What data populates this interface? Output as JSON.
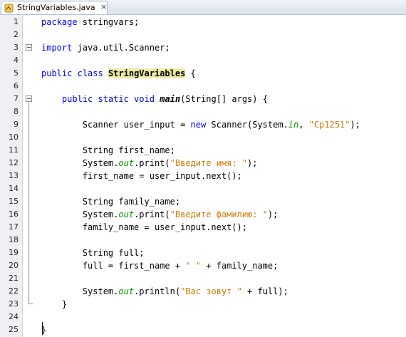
{
  "tab": {
    "title": "StringVariables.java",
    "close": "×",
    "icon": "java-file-icon"
  },
  "colors": {
    "keyword": "#0000e6",
    "string": "#ce7b00",
    "static_field": "#009900",
    "class_highlight": "#eceba5",
    "gutter": "#eef0f4"
  },
  "lines": [
    {
      "n": "1",
      "segments": [
        {
          "t": "package",
          "s": "kw"
        },
        {
          "t": " stringvars;",
          "s": ""
        }
      ]
    },
    {
      "n": "2",
      "segments": []
    },
    {
      "n": "3",
      "segments": [
        {
          "t": "import",
          "s": "kw"
        },
        {
          "t": " java.util.Scanner;",
          "s": ""
        }
      ]
    },
    {
      "n": "4",
      "segments": []
    },
    {
      "n": "5",
      "segments": [
        {
          "t": "public",
          "s": "kw"
        },
        {
          "t": " ",
          "s": ""
        },
        {
          "t": "class",
          "s": "kw"
        },
        {
          "t": " ",
          "s": ""
        },
        {
          "t": "StringVariables",
          "s": "cls-hl"
        },
        {
          "t": " {",
          "s": ""
        }
      ]
    },
    {
      "n": "6",
      "segments": []
    },
    {
      "n": "7",
      "segments": [
        {
          "t": "    ",
          "s": ""
        },
        {
          "t": "public",
          "s": "kw"
        },
        {
          "t": " ",
          "s": ""
        },
        {
          "t": "static",
          "s": "kw"
        },
        {
          "t": " ",
          "s": ""
        },
        {
          "t": "void",
          "s": "kw"
        },
        {
          "t": " ",
          "s": ""
        },
        {
          "t": "main",
          "s": "mth"
        },
        {
          "t": "(String[] args) {",
          "s": ""
        }
      ]
    },
    {
      "n": "8",
      "segments": []
    },
    {
      "n": "9",
      "segments": [
        {
          "t": "        Scanner user_input = ",
          "s": ""
        },
        {
          "t": "new",
          "s": "kw"
        },
        {
          "t": " Scanner(System.",
          "s": ""
        },
        {
          "t": "in",
          "s": "fld"
        },
        {
          "t": ", ",
          "s": ""
        },
        {
          "t": "\"Cp1251\"",
          "s": "str"
        },
        {
          "t": ");",
          "s": ""
        }
      ]
    },
    {
      "n": "10",
      "segments": []
    },
    {
      "n": "11",
      "segments": [
        {
          "t": "        String first_name;",
          "s": ""
        }
      ]
    },
    {
      "n": "12",
      "segments": [
        {
          "t": "        System.",
          "s": ""
        },
        {
          "t": "out",
          "s": "fld"
        },
        {
          "t": ".print(",
          "s": ""
        },
        {
          "t": "\"Введите имя: \"",
          "s": "str"
        },
        {
          "t": ");",
          "s": ""
        }
      ]
    },
    {
      "n": "13",
      "segments": [
        {
          "t": "        first_name = user_input.next();",
          "s": ""
        }
      ]
    },
    {
      "n": "14",
      "segments": []
    },
    {
      "n": "15",
      "segments": [
        {
          "t": "        String family_name;",
          "s": ""
        }
      ]
    },
    {
      "n": "16",
      "segments": [
        {
          "t": "        System.",
          "s": ""
        },
        {
          "t": "out",
          "s": "fld"
        },
        {
          "t": ".print(",
          "s": ""
        },
        {
          "t": "\"Введите фамилию: \"",
          "s": "str"
        },
        {
          "t": ");",
          "s": ""
        }
      ]
    },
    {
      "n": "17",
      "segments": [
        {
          "t": "        family_name = user_input.next();",
          "s": ""
        }
      ]
    },
    {
      "n": "18",
      "segments": []
    },
    {
      "n": "19",
      "segments": [
        {
          "t": "        String full;",
          "s": ""
        }
      ]
    },
    {
      "n": "20",
      "segments": [
        {
          "t": "        full = first_name + ",
          "s": ""
        },
        {
          "t": "\" \"",
          "s": "str"
        },
        {
          "t": " + family_name;",
          "s": ""
        }
      ]
    },
    {
      "n": "21",
      "segments": []
    },
    {
      "n": "22",
      "segments": [
        {
          "t": "        System.",
          "s": ""
        },
        {
          "t": "out",
          "s": "fld"
        },
        {
          "t": ".println(",
          "s": ""
        },
        {
          "t": "\"Вас зовут \"",
          "s": "str"
        },
        {
          "t": " + full);",
          "s": ""
        }
      ]
    },
    {
      "n": "23",
      "segments": [
        {
          "t": "    }",
          "s": ""
        }
      ]
    },
    {
      "n": "24",
      "segments": []
    },
    {
      "n": "25",
      "segments": [
        {
          "t": "}",
          "s": ""
        }
      ]
    }
  ]
}
